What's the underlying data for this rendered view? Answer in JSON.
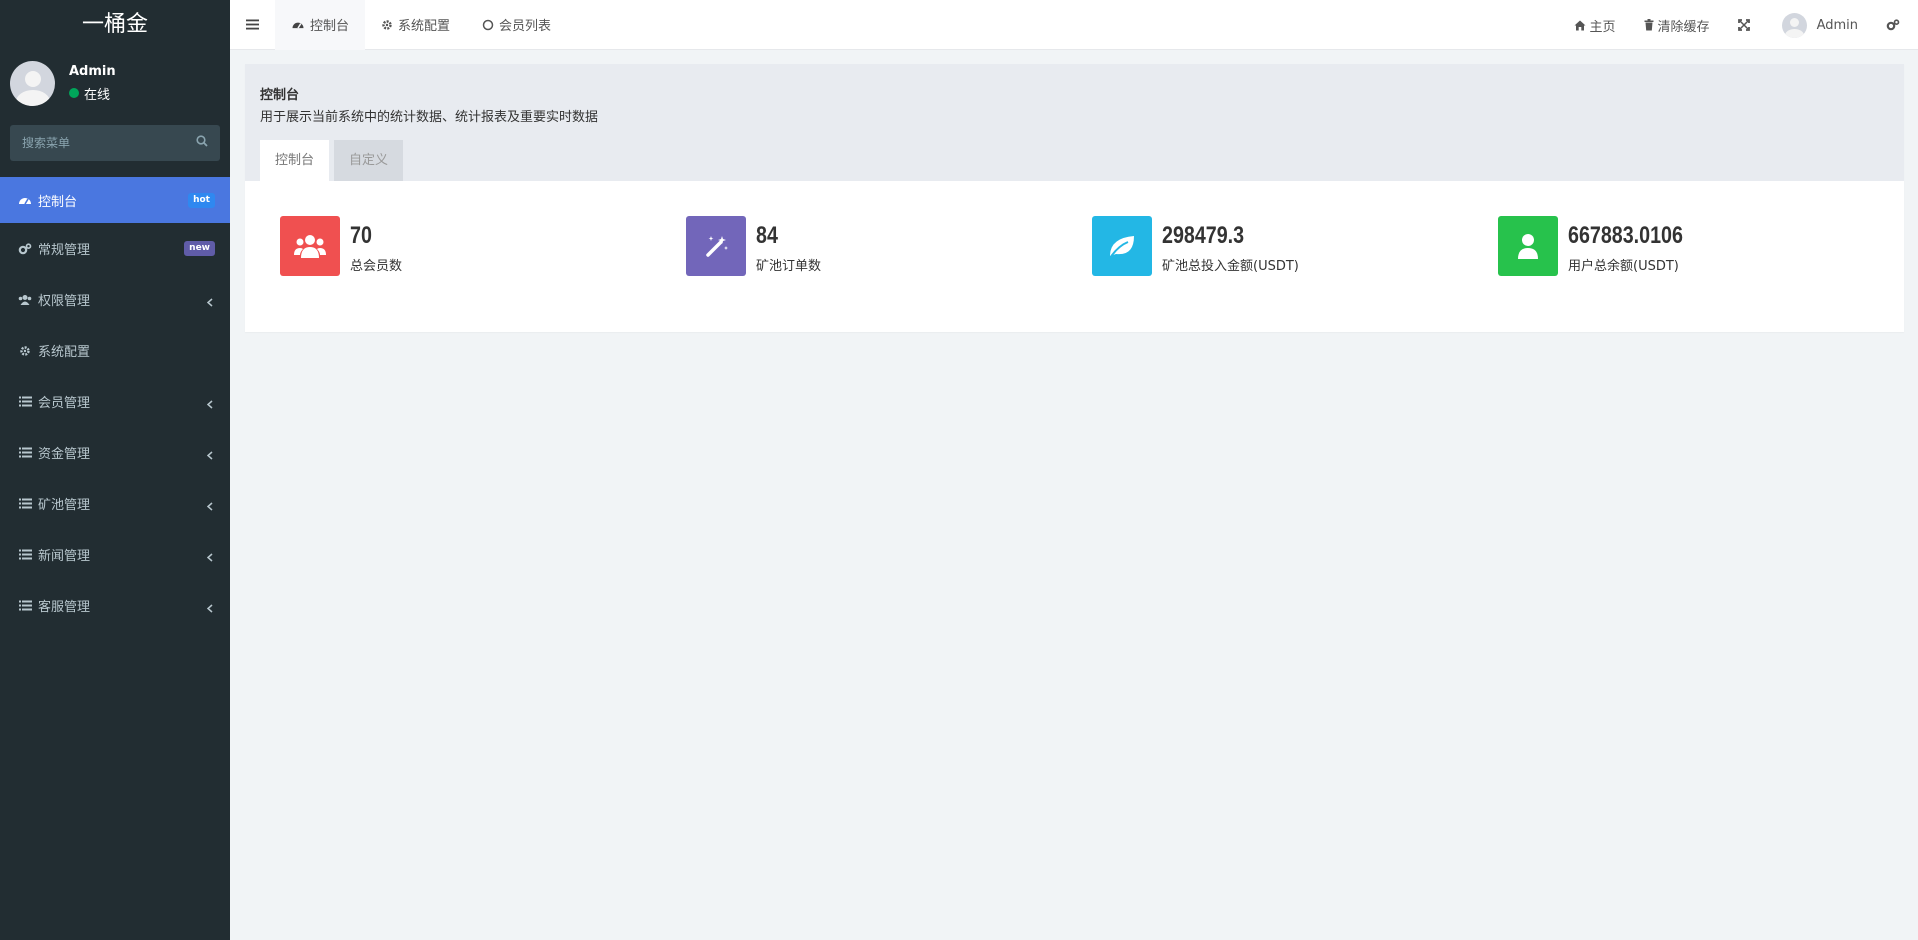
{
  "brand": {
    "title": "一桶金"
  },
  "user": {
    "name": "Admin",
    "status": "在线"
  },
  "search": {
    "placeholder": "搜索菜单"
  },
  "menu": [
    {
      "label": "控制台",
      "icon": "dashboard-icon",
      "badge": "hot",
      "active": true
    },
    {
      "label": "常规管理",
      "icon": "cogs-icon",
      "badge": "new"
    },
    {
      "label": "权限管理",
      "icon": "users-icon",
      "chevron": true
    },
    {
      "label": "系统配置",
      "icon": "gear-icon"
    },
    {
      "label": "会员管理",
      "icon": "list-icon",
      "chevron": true
    },
    {
      "label": "资金管理",
      "icon": "list-icon",
      "chevron": true
    },
    {
      "label": "矿池管理",
      "icon": "list-icon",
      "chevron": true
    },
    {
      "label": "新闻管理",
      "icon": "list-icon",
      "chevron": true
    },
    {
      "label": "客服管理",
      "icon": "list-icon",
      "chevron": true
    }
  ],
  "topbar": {
    "tabs": [
      {
        "label": "控制台",
        "icon": "dashboard-icon"
      },
      {
        "label": "系统配置",
        "icon": "gear-icon"
      },
      {
        "label": "会员列表",
        "icon": "circle-icon"
      }
    ],
    "right": {
      "home": "主页",
      "clear_cache": "清除缓存",
      "user": "Admin"
    }
  },
  "panel": {
    "title": "控制台",
    "description": "用于展示当前系统中的统计数据、统计报表及重要实时数据",
    "tabs": [
      "控制台",
      "自定义"
    ]
  },
  "stats": [
    {
      "value": "70",
      "label": "总会员数",
      "color": "#f05050",
      "icon": "users-icon"
    },
    {
      "value": "84",
      "label": "矿池订单数",
      "color": "#7266ba",
      "icon": "magic-wand-icon"
    },
    {
      "value": "298479.3",
      "label": "矿池总投入金额(USDT)",
      "color": "#23b7e5",
      "icon": "leaf-icon"
    },
    {
      "value": "667883.0106",
      "label": "用户总余额(USDT)",
      "color": "#27c24c",
      "icon": "user-icon"
    }
  ],
  "colors": {
    "sidebar": "#222d32",
    "active": "#4a77e0",
    "hot": "#2f88f0",
    "new": "#605ca8",
    "online": "#00a65a"
  }
}
